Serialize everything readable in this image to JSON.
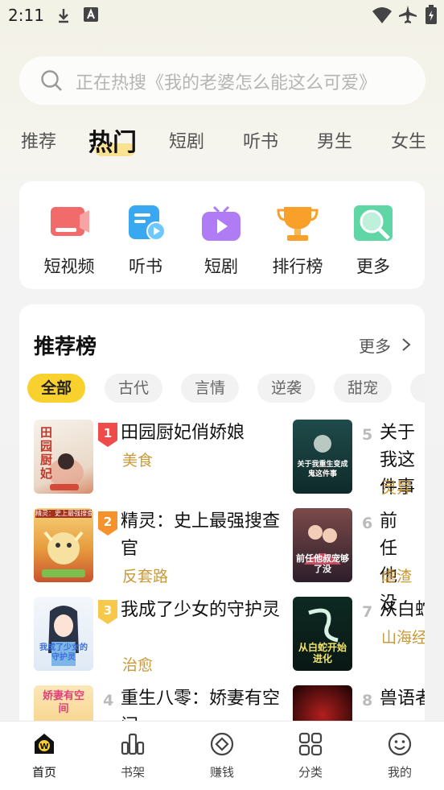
{
  "status_bar": {
    "time": "2:11"
  },
  "search": {
    "placeholder": "正在热搜《我的老婆怎么能这么可爱》"
  },
  "tabs": [
    "推荐",
    "热门",
    "短剧",
    "听书",
    "男生",
    "女生"
  ],
  "active_tab": "热门",
  "quick_entries": [
    {
      "label": "短视频",
      "icon": "short-video-icon"
    },
    {
      "label": "听书",
      "icon": "audiobook-icon"
    },
    {
      "label": "短剧",
      "icon": "short-drama-icon"
    },
    {
      "label": "排行榜",
      "icon": "trophy-icon"
    },
    {
      "label": "更多",
      "icon": "more-search-icon"
    }
  ],
  "ranking": {
    "title": "推荐榜",
    "more": "更多",
    "chips": [
      "全部",
      "古代",
      "言情",
      "逆袭",
      "甜宠"
    ],
    "left_books": [
      {
        "rank": "1",
        "title": "田园厨妃俏娇娘",
        "tag": "美食",
        "cover_text": "田园厨妃"
      },
      {
        "rank": "2",
        "title": "精灵：史上最强搜查官",
        "tag": "反套路",
        "cover_text": "精灵：史上最强搜查官"
      },
      {
        "rank": "3",
        "title": "我成了少女的守护灵",
        "tag": "治愈",
        "cover_text": "我成了少女的守护灵"
      },
      {
        "rank": "4",
        "title": "重生八零：娇妻有空间",
        "tag": "",
        "cover_text": "娇妻有空间"
      }
    ],
    "right_books": [
      {
        "rank": "5",
        "title": "关于我这件事",
        "tag": "灵异",
        "cover_text": "关于我重生变成鬼这件事"
      },
      {
        "rank": "6",
        "title": "前任他没",
        "tag": "虐渣",
        "cover_text": "前任他叔宠够了没"
      },
      {
        "rank": "7",
        "title": "从白蛇",
        "tag": "山海经",
        "cover_text": "从白蛇开始进化"
      },
      {
        "rank": "8",
        "title": "兽语者",
        "tag": "",
        "cover_text": ""
      }
    ]
  },
  "bottom_nav": [
    {
      "label": "首页",
      "icon": "home-icon",
      "active": true
    },
    {
      "label": "书架",
      "icon": "bookshelf-icon",
      "active": false
    },
    {
      "label": "赚钱",
      "icon": "earn-coin-icon",
      "active": false
    },
    {
      "label": "分类",
      "icon": "category-grid-icon",
      "active": false
    },
    {
      "label": "我的",
      "icon": "profile-smile-icon",
      "active": false
    }
  ],
  "colors": {
    "accent": "#f9d12f",
    "tag": "#c89a3a",
    "rank1": "#ef4b4b",
    "rank2": "#f5922b",
    "rank3": "#f6c94a"
  }
}
